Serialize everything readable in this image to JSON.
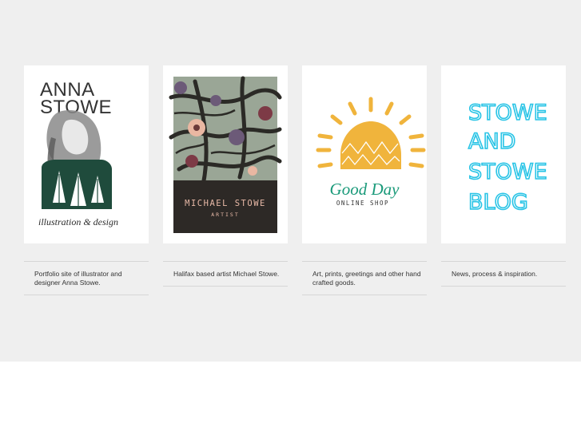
{
  "cards": [
    {
      "title_line1": "ANNA",
      "title_line2": "STOWE",
      "subtitle": "illustration & design",
      "description": "Portfolio site of illustrator and designer Anna Stowe."
    },
    {
      "title": "MICHAEL STOWE",
      "subtitle": "ARTIST",
      "description": "Halifax based artist Michael Stowe."
    },
    {
      "title": "Good Day",
      "subtitle": "ONLINE SHOP",
      "description": "Art, prints, greetings and other hand crafted goods."
    },
    {
      "lines": [
        "STOWE",
        "AND",
        "STOWE",
        "BLOG"
      ],
      "description": "News, process & inspiration."
    }
  ],
  "colors": {
    "band": "#efefef",
    "michael_panel": "#2d2926",
    "good_day_sun": "#f0b43c",
    "good_day_title": "#1a9a7a",
    "blog_ink": "#29c4e6"
  }
}
